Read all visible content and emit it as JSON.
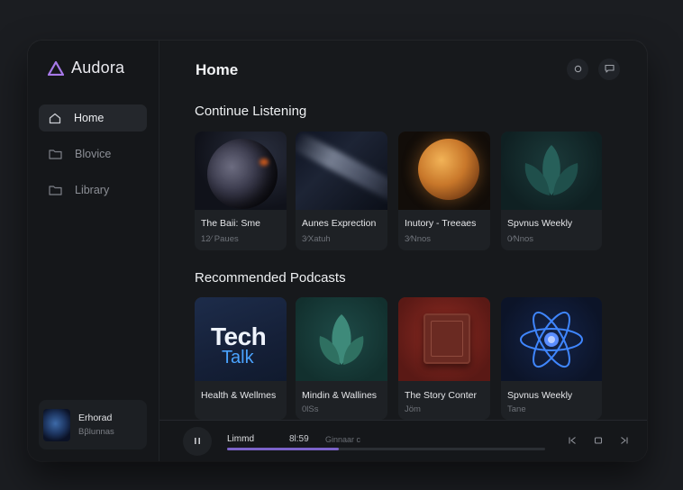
{
  "app": {
    "name": "Audora"
  },
  "sidebar": {
    "items": [
      {
        "label": "Home",
        "icon": "home-icon",
        "active": true
      },
      {
        "label": "Blovice",
        "icon": "folder-icon",
        "active": false
      },
      {
        "label": "Library",
        "icon": "folder-icon",
        "active": false
      }
    ]
  },
  "mini_player": {
    "title": "Erhorad",
    "subtitle": "Ββlunnas"
  },
  "main": {
    "title": "Home",
    "continue": {
      "heading": "Continue Listening",
      "cards": [
        {
          "title": "The Baii: Sme",
          "sub": "12⁄ Paues"
        },
        {
          "title": "Aunes Exprection",
          "sub": "3⁄Xatuh"
        },
        {
          "title": "Inutory - Treeaes",
          "sub": "3⁄Nnos"
        },
        {
          "title": "Spvnus Weekly",
          "sub": "0⁄Nnos"
        }
      ]
    },
    "recommended": {
      "heading": "Recommended Podcasts",
      "cards": [
        {
          "title": "Health & Wellmes",
          "sub": "",
          "art_line1": "Tech",
          "art_line2": "Talk"
        },
        {
          "title": "Mindin & Wallines",
          "sub": "0lSs"
        },
        {
          "title": "The Story Conter",
          "sub": "Jöm"
        },
        {
          "title": "Spvnus Weekly",
          "sub": "Tane"
        }
      ]
    }
  },
  "player": {
    "title": "Limmd",
    "time": "8l:59",
    "subtitle": "Ginnaar c",
    "progress": 0.35
  },
  "colors": {
    "accent": "#7b63c9",
    "logo": "#a779e8",
    "talk": "#4aa3ff"
  }
}
